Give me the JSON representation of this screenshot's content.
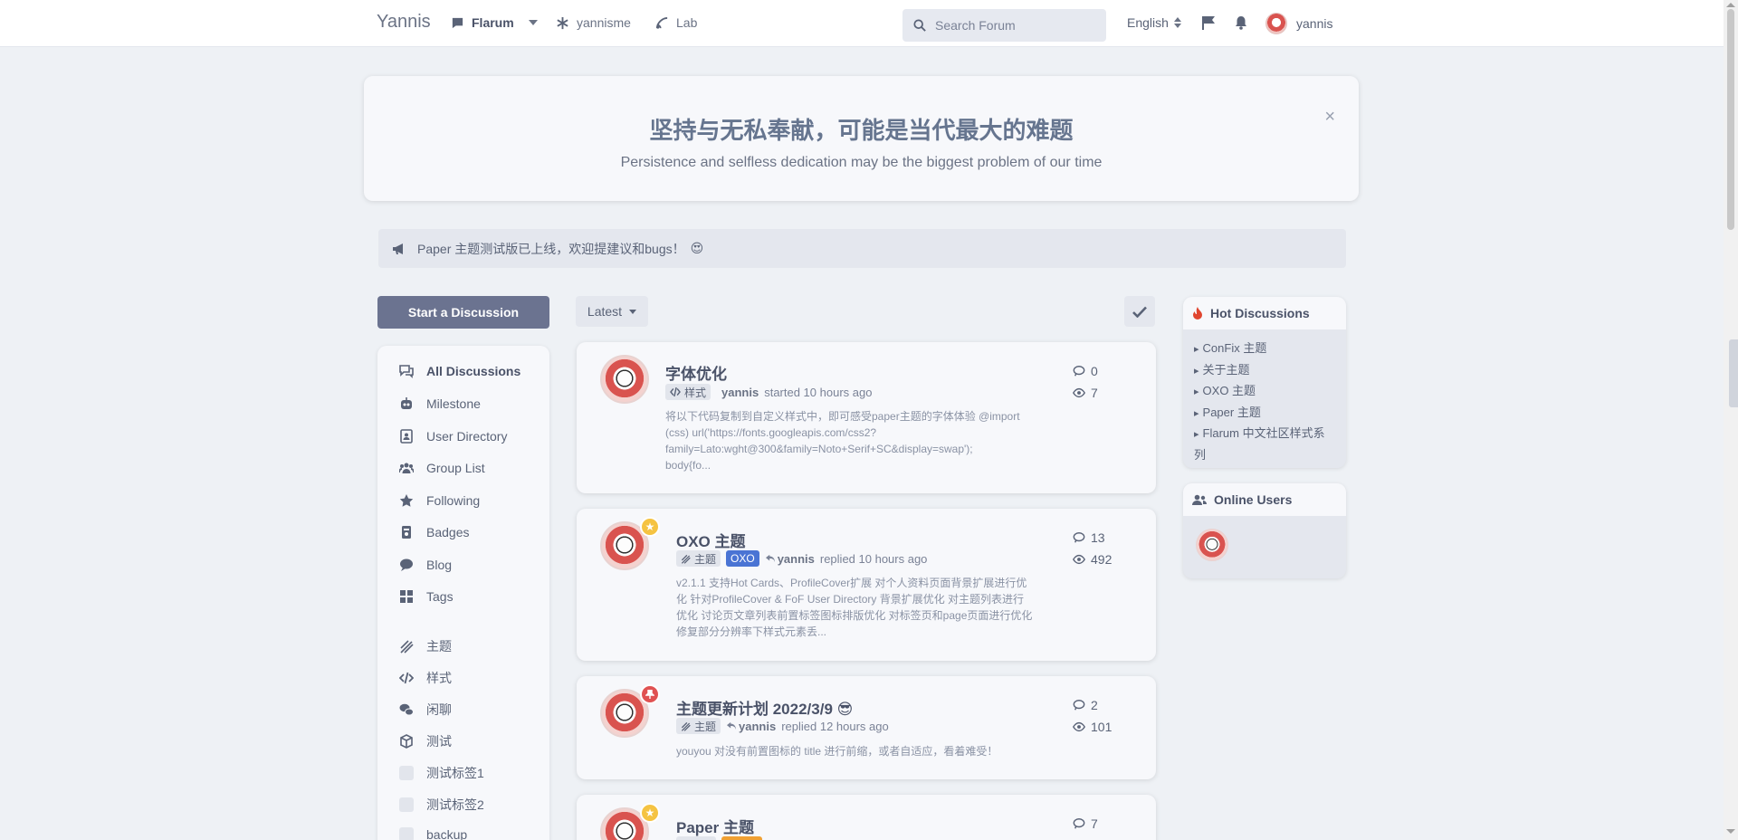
{
  "header": {
    "brand": "Yannis",
    "nav": [
      {
        "label": "Flarum",
        "icon": "chat-icon"
      },
      {
        "label": "yannisme",
        "icon": "asterisk-icon"
      },
      {
        "label": "Lab",
        "icon": "flask-icon"
      }
    ],
    "search_placeholder": "Search Forum",
    "language": "English",
    "username": "yannis"
  },
  "hero": {
    "title": "坚持与无私奉献，可能是当代最大的难题",
    "subtitle": "Persistence and selfless dedication may be the biggest problem of our time",
    "close": "×"
  },
  "announcement": {
    "text": "Paper 主题测试版已上线，欢迎提建议和bugs！",
    "emoji": "😍"
  },
  "sidebar": {
    "start_button": "Start a Discussion",
    "items": [
      {
        "label": "All Discussions",
        "icon": "comments-icon",
        "active": true
      },
      {
        "label": "Milestone",
        "icon": "robot-icon"
      },
      {
        "label": "User Directory",
        "icon": "address-book-icon"
      },
      {
        "label": "Group List",
        "icon": "users-icon"
      },
      {
        "label": "Following",
        "icon": "star-icon"
      },
      {
        "label": "Badges",
        "icon": "badge-icon"
      },
      {
        "label": "Blog",
        "icon": "comment-icon"
      },
      {
        "label": "Tags",
        "icon": "grid-icon"
      },
      {
        "label": "主题",
        "icon": "paint-icon"
      },
      {
        "label": "样式",
        "icon": "code-icon"
      },
      {
        "label": "闲聊",
        "icon": "chat-bubbles-icon"
      },
      {
        "label": "测试",
        "icon": "cube-icon"
      },
      {
        "label": "测试标签1",
        "icon": "tag-box-icon"
      },
      {
        "label": "测试标签2",
        "icon": "tag-box-icon"
      },
      {
        "label": "backup",
        "icon": "tag-box-icon"
      }
    ]
  },
  "toolbar": {
    "sort_label": "Latest"
  },
  "discussions": [
    {
      "title": "字体优化",
      "tags": [
        {
          "label": "样式",
          "color": "gray"
        }
      ],
      "user": "yannis",
      "action": "started 10 hours ago",
      "excerpt": [
        "将以下代码复制到自定义样式中，即可感受paper主题的字体体验 @import",
        "(css) url('https://fonts.googleapis.com/css2?",
        "family=Lato:wght@300&family=Noto+Serif+SC&display=swap');",
        "body{fo..."
      ],
      "replies": "0",
      "views": "7"
    },
    {
      "title": "OXO 主题",
      "tags": [
        {
          "label": "主题",
          "color": "gray"
        },
        {
          "label": "OXO",
          "color": "blue"
        }
      ],
      "user": "yannis",
      "action": "replied 10 hours ago",
      "excerpt": [
        "v2.1.1 支持Hot Cards、ProfileCover扩展 对个人资料页面背景扩展进行优",
        "化 针对ProfileCover & FoF User Directory 背景扩展优化 对主题列表进行",
        "优化 讨论页文章列表前置标签图标排版优化 对标签页和page页面进行优化",
        "修复部分分辨率下样式元素丢..."
      ],
      "replies": "13",
      "views": "492"
    },
    {
      "title": "主题更新计划 2022/3/9 😎",
      "tags": [
        {
          "label": "主题",
          "color": "gray"
        }
      ],
      "user": "yannis",
      "action": "replied 12 hours ago",
      "excerpt": [
        "youyou 对没有前置图标的 title 进行前缩，或者自适应，看着难受！"
      ],
      "replies": "2",
      "views": "101"
    },
    {
      "title": "Paper 主题",
      "tags": [],
      "replies": "7"
    }
  ],
  "widgets": {
    "hot": {
      "title": "Hot Discussions",
      "items": [
        "ConFix 主题",
        "关于主题",
        "OXO 主题",
        "Paper 主题",
        "Flarum 中文社区样式系列"
      ]
    },
    "online": {
      "title": "Online Users"
    }
  },
  "colors": {
    "background": "#eef1f5",
    "card": "#f7f8fb",
    "primary_button": "#6b7390",
    "tag_blue": "#4a74d4",
    "sticky_badge": "#f5c342",
    "pin_badge": "#e05252",
    "fire": "#e0452f"
  }
}
